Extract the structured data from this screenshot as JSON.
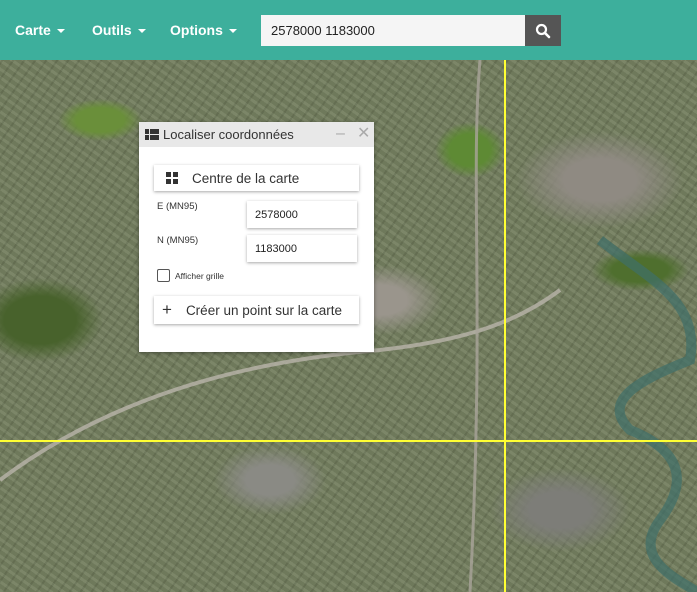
{
  "navbar": {
    "menus": [
      {
        "label": "Carte"
      },
      {
        "label": "Outils"
      },
      {
        "label": "Options"
      }
    ],
    "search_value": "2578000 1183000",
    "search_icon": "search-icon"
  },
  "panel": {
    "title": "Localiser coordonnées",
    "title_icon": "grid-icon",
    "center_button": "Centre de la carte",
    "east_label": "E (MN95)",
    "east_value": "2578000",
    "north_label": "N (MN95)",
    "north_value": "1183000",
    "grid_checkbox_label": "Afficher grille",
    "grid_checked": false,
    "create_point_button": "Créer un point sur la carte"
  },
  "colors": {
    "navbar": "#3daf9c",
    "search_button": "#555555",
    "grid_lines": "#ffff33"
  }
}
